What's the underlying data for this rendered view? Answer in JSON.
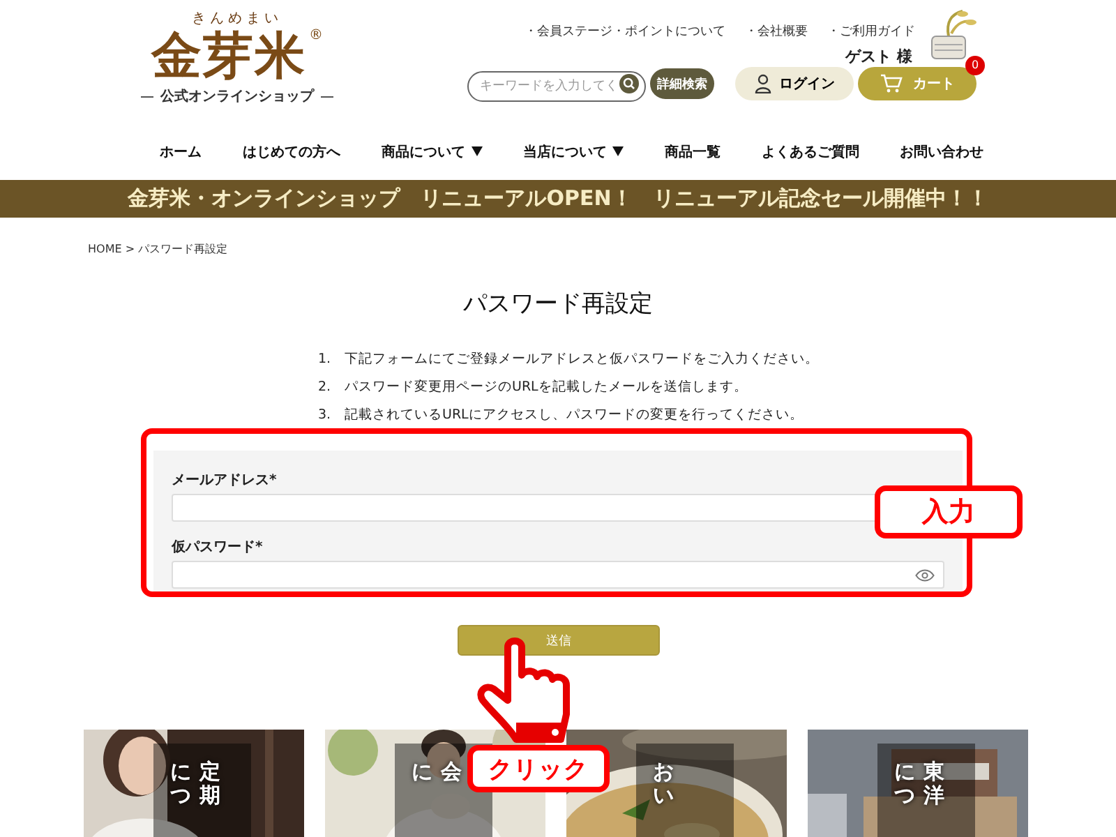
{
  "logo": {
    "reading": "きんめまい",
    "name": "金芽米",
    "mark": "®",
    "tagline": "公式オンラインショップ"
  },
  "header_links": [
    "・会員ステージ・ポイントについて",
    "・会社概要",
    "・ご利用ガイド"
  ],
  "user": "ゲスト 様",
  "search": {
    "placeholder": "キーワードを入力してく"
  },
  "advanced_search": "詳細検索",
  "login": "ログイン",
  "cart": {
    "label": "カート",
    "count": "0"
  },
  "nav": [
    {
      "label": "ホーム",
      "dropdown": false
    },
    {
      "label": "はじめての方へ",
      "dropdown": false
    },
    {
      "label": "商品について",
      "dropdown": true
    },
    {
      "label": "当店について",
      "dropdown": true
    },
    {
      "label": "商品一覧",
      "dropdown": false
    },
    {
      "label": "よくあるご質問",
      "dropdown": false
    },
    {
      "label": "お問い合わせ",
      "dropdown": false
    }
  ],
  "banner": "金芽米・オンラインショップ　リニューアルOPEN！　リニューアル記念セール開催中！！",
  "breadcrumb": "HOME > パスワード再設定",
  "title": "パスワード再設定",
  "steps": [
    {
      "number": "1.",
      "text": "下記フォームにてご登録メールアドレスと仮パスワードをご入力ください。"
    },
    {
      "number": "2.",
      "text": "パスワード変更用ページのURLを記載したメールを送信します。"
    },
    {
      "number": "3.",
      "text": "記載されているURLにアクセスし、パスワードの変更を行ってください。"
    }
  ],
  "form": [
    {
      "label": "メールアドレス*",
      "kind": "text"
    },
    {
      "label": "仮パスワード*",
      "kind": "password"
    }
  ],
  "submit": "送信",
  "tiles": [
    {
      "kind": "woman",
      "columns": [
        "につ",
        "定期"
      ]
    },
    {
      "kind": "eating",
      "columns": [
        "に",
        "会"
      ]
    },
    {
      "kind": "rice",
      "columns": [
        "おい"
      ]
    },
    {
      "kind": "building",
      "columns": [
        "につ",
        "東洋"
      ]
    }
  ],
  "annotations": {
    "input_label": "入力",
    "click_label": "クリック"
  }
}
